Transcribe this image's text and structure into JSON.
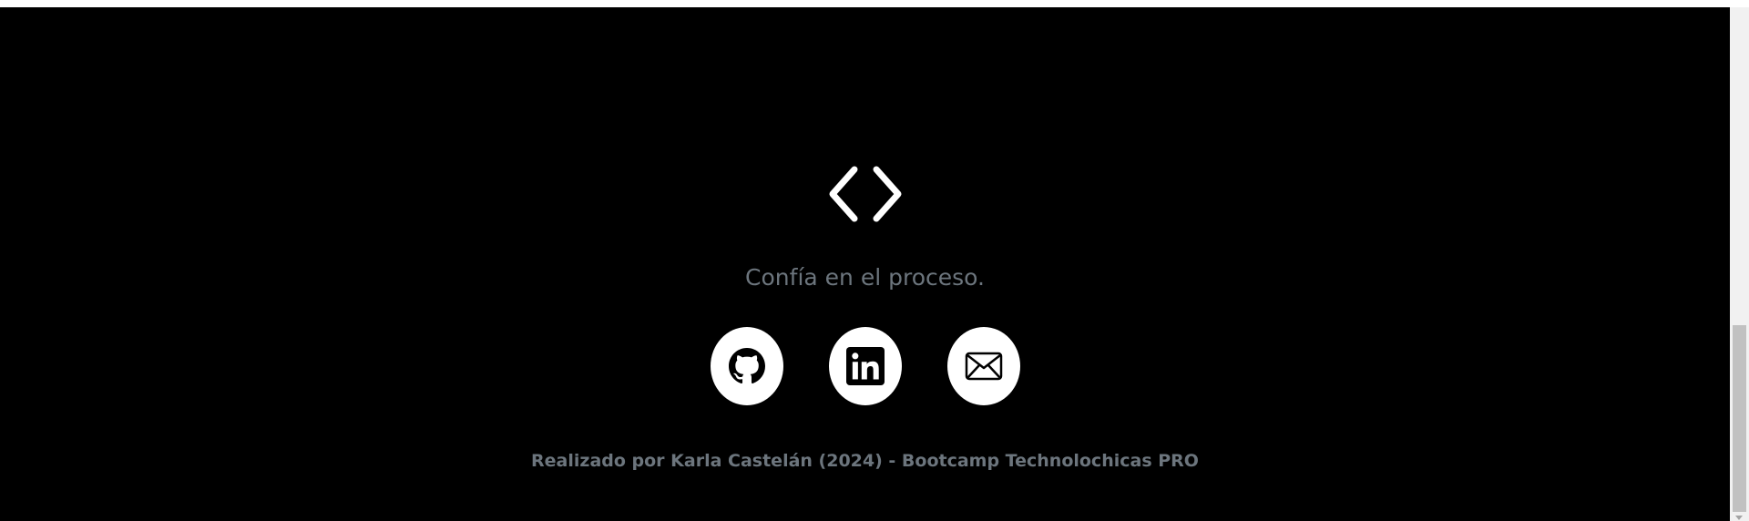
{
  "footer": {
    "logo_icon": "code-brackets-icon",
    "tagline": "Confía en el proceso.",
    "social_links": [
      {
        "name": "GitHub",
        "icon": "github-icon"
      },
      {
        "name": "LinkedIn",
        "icon": "linkedin-icon"
      },
      {
        "name": "Email",
        "icon": "envelope-icon"
      }
    ],
    "credit": "Realizado por Karla Castelán (2024) - Bootcamp Technolochicas PRO"
  },
  "colors": {
    "background": "#000000",
    "muted_text": "#6c757d",
    "icon_circle": "#ffffff"
  }
}
